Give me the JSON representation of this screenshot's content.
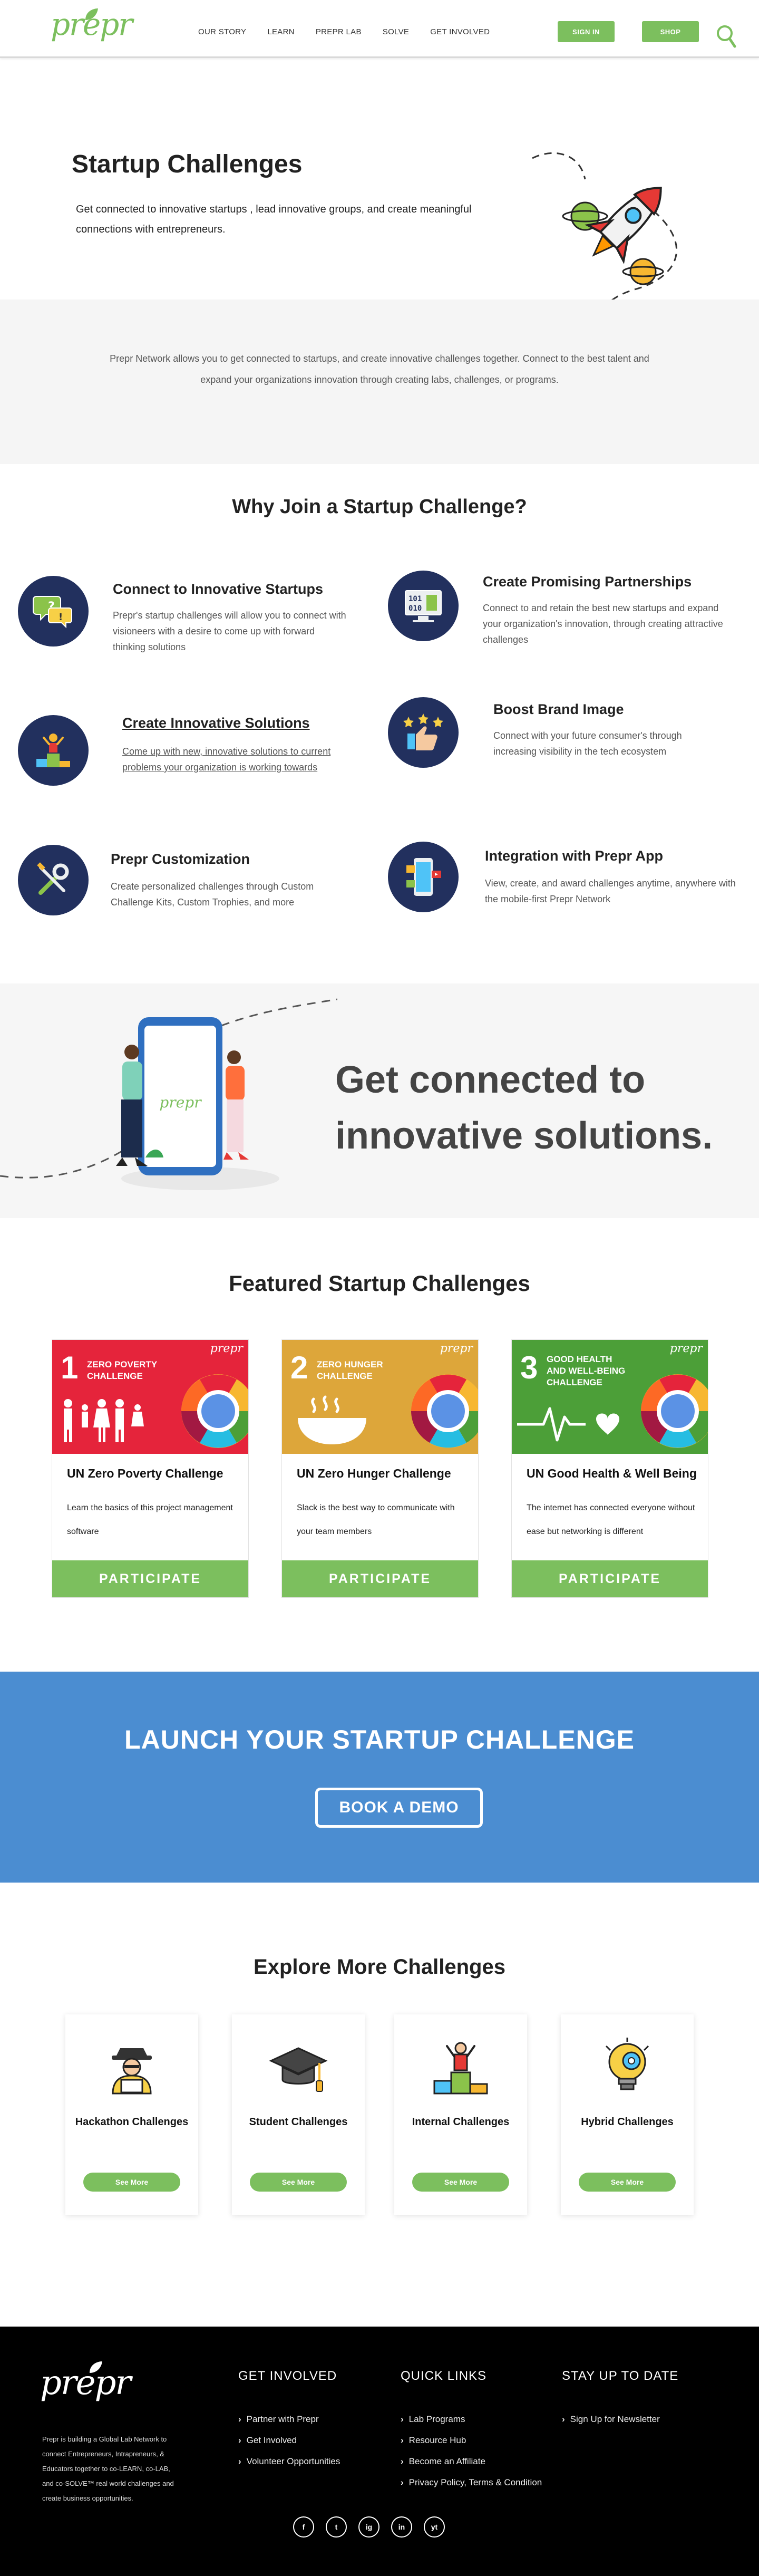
{
  "header": {
    "logo": "prepr",
    "nav": [
      "OUR STORY",
      "LEARN",
      "PREPR LAB",
      "SOLVE",
      "GET INVOLVED"
    ],
    "sign_in": "SIGN IN",
    "shop": "SHOP"
  },
  "hero": {
    "title": "Startup Challenges",
    "subtitle": "Get connected to innovative startups , lead innovative groups, and create meaningful connections with entrepreneurs."
  },
  "intro": {
    "text": "Prepr Network allows you to get connected to startups, and create innovative challenges together. Connect to the best talent and expand your organizations innovation through creating labs, challenges, or programs."
  },
  "why": {
    "title": "Why Join a Startup Challenge?",
    "features": [
      {
        "icon": "chat-icon",
        "title": "Connect to Innovative Startups",
        "text": "Prepr's startup challenges will allow you to connect with visioneers with a desire to come up with forward thinking solutions"
      },
      {
        "icon": "data-screen-icon",
        "title": "Create Promising Partnerships",
        "text": "Connect to and retain the best new startups and expand your organization's innovation, through creating attractive challenges"
      },
      {
        "icon": "podium-icon",
        "title": "Create Innovative Solutions",
        "text": "Come up with new, innovative solutions to current problems your organization is working towards"
      },
      {
        "icon": "thumbs-up-stars-icon",
        "title": "Boost Brand Image",
        "text": "Connect with your future consumer's through increasing visibility in the tech ecosystem"
      },
      {
        "icon": "tools-icon",
        "title": "Prepr Customization",
        "text": "Create personalized challenges through Custom Challenge Kits, Custom Trophies, and more"
      },
      {
        "icon": "mobile-app-icon",
        "title": "Integration with Prepr App",
        "text": "View, create, and award challenges anytime, anywhere with the mobile-first Prepr Network"
      }
    ]
  },
  "band": {
    "headline": "Get connected to innovative solutions.",
    "phone_logo": "prepr"
  },
  "featured": {
    "title": "Featured Startup Challenges",
    "cards": [
      {
        "num": "1",
        "banner": "ZERO POVERTY CHALLENGE",
        "color": "#e5243b",
        "title": "UN Zero Poverty Challenge",
        "text": "Learn the basics of this project management software",
        "cta": "PARTICIPATE"
      },
      {
        "num": "2",
        "banner": "ZERO HUNGER CHALLENGE",
        "color": "#dda63a",
        "title": "UN Zero Hunger Challenge",
        "text": "Slack is the best way to communicate with your team members",
        "cta": "PARTICIPATE"
      },
      {
        "num": "3",
        "banner": "GOOD HEALTH AND WELL-BEING CHALLENGE",
        "color": "#4c9f38",
        "title": "UN Good Health & Well Being",
        "text": "The internet has connected everyone without ease but networking is different",
        "cta": "PARTICIPATE"
      }
    ]
  },
  "launch": {
    "title": "LAUNCH YOUR STARTUP CHALLENGE",
    "cta": "BOOK A DEMO"
  },
  "explore": {
    "title": "Explore More Challenges",
    "cards": [
      {
        "icon": "hackathon-icon",
        "title": "Hackathon Challenges",
        "cta": "See More"
      },
      {
        "icon": "graduation-cap-icon",
        "title": "Student Challenges",
        "cta": "See More"
      },
      {
        "icon": "podium-icon",
        "title": "Internal Challenges",
        "cta": "See More"
      },
      {
        "icon": "lightbulb-gear-icon",
        "title": "Hybrid Challenges",
        "cta": "See More"
      }
    ]
  },
  "footer": {
    "logo": "prepr",
    "blurb": "Prepr is building a Global Lab Network to connect Entrepreneurs, Intrapreneurs, & Educators together to co-LEARN, co-LAB, and co-SOLVE™ real world challenges and create business opportunities.",
    "columns": [
      {
        "title": "GET INVOLVED",
        "items": [
          "Partner with Prepr",
          "Get Involved",
          "Volunteer Opportunities"
        ]
      },
      {
        "title": "QUICK LINKS",
        "items": [
          "Lab Programs",
          "Resource Hub",
          "Become an Affiliate",
          "Privacy Policy, Terms & Condition"
        ]
      },
      {
        "title": "STAY UP TO DATE",
        "items": [
          "Sign Up for Newsletter"
        ]
      }
    ],
    "socials": [
      "f",
      "t",
      "ig",
      "in",
      "yt"
    ]
  }
}
